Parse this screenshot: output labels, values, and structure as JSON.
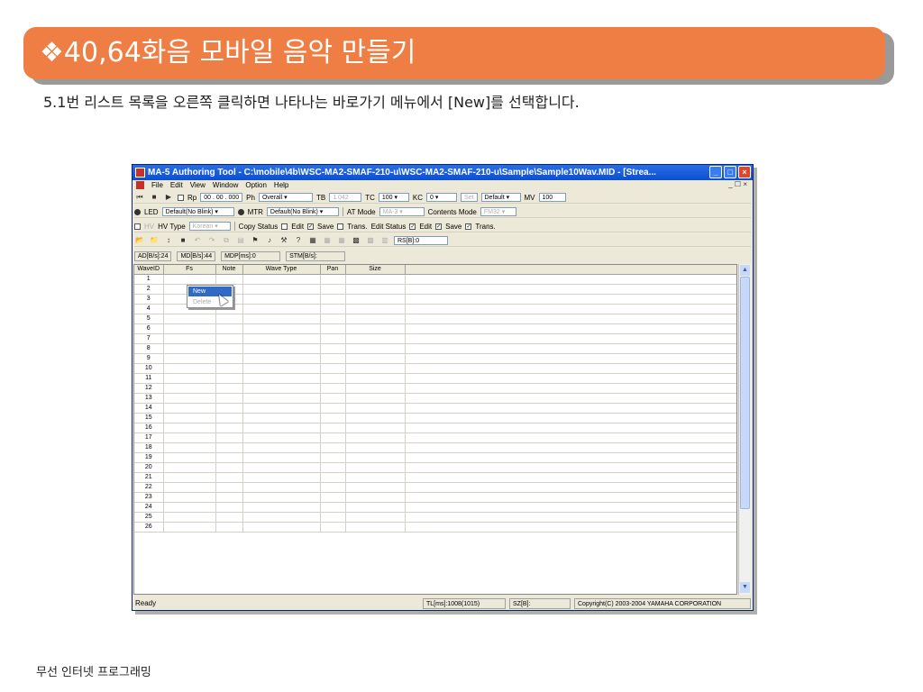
{
  "slide": {
    "title": "❖40,64화음 모바일 음악 만들기",
    "subtitle": "5.1번 리스트 목록을 오른쪽 클릭하면 나타나는 바로가기 메뉴에서 [New]를 선택합니다.",
    "footer": "무선 인터넷 프로그래밍"
  },
  "window": {
    "title": "MA-5 Authoring Tool - C:\\mobile\\4b\\WSC-MA2-SMAF-210-u\\WSC-MA2-SMAF-210-u\\Sample\\Sample10Wav.MID - [Strea...",
    "buttons": {
      "minimize": "_",
      "maximize": "□",
      "close": "×"
    },
    "mdi_controls": "_ ☐ ×",
    "menu": [
      "File",
      "Edit",
      "View",
      "Window",
      "Option",
      "Help"
    ]
  },
  "toolbar1": {
    "rp_label": "Rp",
    "time_value": "00 . 00 . 000",
    "ph_label": "Ph",
    "ph_value": "Overall",
    "tb_label": "TB",
    "tb_value": "1.042",
    "tc_label": "TC",
    "tc_value": "100",
    "kc_label": "KC",
    "kc_value": "0",
    "set_label": "Set",
    "default_value": "Default",
    "mv_label": "MV",
    "mv_value": "100"
  },
  "toolbar2": {
    "led_label": "LED",
    "led_value": "Default(No Blink)",
    "mtr_label": "MTR",
    "mtr_value": "Default(No Blink)",
    "at_mode_label": "AT Mode",
    "at_mode_value": "MA-3",
    "contents_mode_label": "Contents Mode",
    "contents_mode_value": "FM32"
  },
  "toolbar3": {
    "hv_label": "HV",
    "hv_type_label": "HV Type",
    "hv_type_value": "Korean",
    "copy_status_label": "Copy Status",
    "edit_label": "Edit",
    "save_label": "Save",
    "trans_label": "Trans.",
    "edit_status_label": "Edit Status",
    "edit2_label": "Edit",
    "save2_label": "Save",
    "trans2_label": "Trans."
  },
  "toolbar4": {
    "rs_value": "RS[B]:0"
  },
  "infobar": [
    "AD[B/s]:24",
    "MD[B/s]:44",
    "MDP[ms]:0",
    "STM[B/s]:"
  ],
  "grid": {
    "columns": [
      "WaveID",
      "Fs",
      "Note",
      "Wave Type",
      "Pan",
      "Size"
    ],
    "rows": [
      "1",
      "2",
      "3",
      "4",
      "5",
      "6",
      "7",
      "8",
      "9",
      "10",
      "11",
      "12",
      "13",
      "14",
      "15",
      "16",
      "17",
      "18",
      "19",
      "20",
      "21",
      "22",
      "23",
      "24",
      "25",
      "26"
    ]
  },
  "context_menu": {
    "new": "New",
    "delete": "Delete"
  },
  "statusbar": {
    "ready": "Ready",
    "tl": "TL[ms]:1008(1015)",
    "sz": "SZ[B]:",
    "copyright": "Copyright(C) 2003-2004 YAMAHA CORPORATION"
  },
  "colors": {
    "banner": "#ee7e44",
    "titlebar": "#0c4fd0",
    "menu_selection": "#316ac5"
  }
}
